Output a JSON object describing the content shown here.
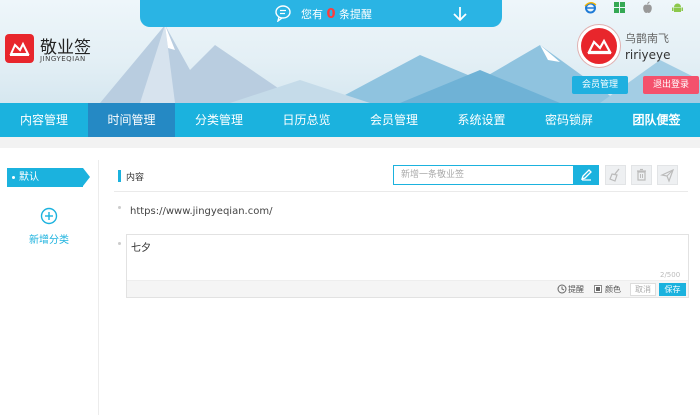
{
  "notice": {
    "prefix": "您有",
    "count": "0",
    "suffix": "条提醒"
  },
  "brand": {
    "title": "敬业签",
    "subtitle": "JINGYEQIAN"
  },
  "platform_icons": [
    "ie-icon",
    "windows-icon",
    "apple-icon",
    "android-icon"
  ],
  "user": {
    "name": "乌鹊南飞",
    "id": "ririyeye"
  },
  "header_buttons": {
    "member": "会员管理",
    "logout": "退出登录"
  },
  "nav": {
    "items": [
      {
        "label": "内容管理",
        "active": false
      },
      {
        "label": "时间管理",
        "active": true
      },
      {
        "label": "分类管理",
        "active": false
      },
      {
        "label": "日历总览",
        "active": false
      },
      {
        "label": "会员管理",
        "active": false
      },
      {
        "label": "系统设置",
        "active": false
      },
      {
        "label": "密码锁屏",
        "active": false
      },
      {
        "label": "团队便签",
        "active": false
      }
    ]
  },
  "sidebar": {
    "default_category": "默认",
    "add_category": "新增分类"
  },
  "main": {
    "section_label": "内容",
    "new_note_placeholder": "新增一条敬业签",
    "notes": [
      {
        "text": "https://www.jingyeqian.com/"
      }
    ],
    "editor": {
      "text": "七夕",
      "counter": "2/500",
      "remind_label": "提醒",
      "color_label": "颜色",
      "cancel_label": "取消",
      "save_label": "保存"
    }
  },
  "colors": {
    "accent": "#1bb2de",
    "nav_active": "#2589c4",
    "logout": "#f4516c",
    "brand_red": "#e8262c"
  }
}
